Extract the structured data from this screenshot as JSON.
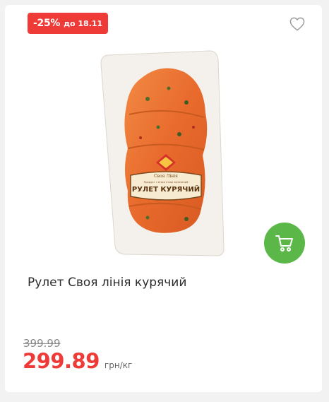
{
  "badge": {
    "discount": "-25%",
    "until": "до 18.11",
    "color": "#ef3b37"
  },
  "icons": {
    "favorite": "heart-outline-icon",
    "cart": "cart-icon"
  },
  "product": {
    "title": "Рулет Своя лінія курячий",
    "package_brand": "Своя Лінія",
    "package_subtitle": "Продукт з м'яса птиці запечений",
    "package_name": "РУЛЕТ КУРЯЧИЙ"
  },
  "price": {
    "old": "399.99",
    "current": "299.89",
    "unit": "грн/кг"
  },
  "colors": {
    "cart_button": "#5bb848",
    "price": "#ef3b37"
  }
}
